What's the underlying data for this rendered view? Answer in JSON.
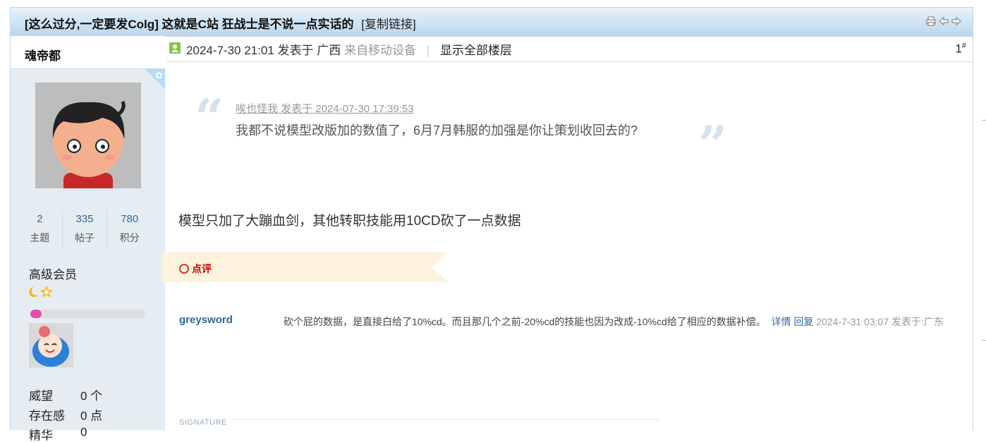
{
  "thread": {
    "title": "[这么过分,一定要发Colg] 这就是C站 狂战士是不说一点实话的",
    "copy_link": "[复制链接]"
  },
  "icons": {
    "print": "printer-icon",
    "prev": "arrow-left-icon",
    "next": "arrow-right-icon"
  },
  "author": {
    "name": "魂帝都",
    "stats": [
      {
        "value": "2",
        "label": "主题"
      },
      {
        "value": "335",
        "label": "帖子"
      },
      {
        "value": "780",
        "label": "积分"
      }
    ],
    "rank": "高级会员",
    "rank_icons": "☾✩",
    "level_progress": 0.1,
    "info": [
      {
        "label": "威望",
        "value": "0 个"
      },
      {
        "label": "存在感",
        "value": "0 点"
      },
      {
        "label": "精华",
        "value": "0"
      }
    ]
  },
  "post": {
    "date": "2024-7-30 21:01",
    "posted_in": "发表于 广西",
    "from_device": "来自移动设备",
    "separator": "|",
    "show_all": "显示全部楼层",
    "floor": "1",
    "floor_mark": "#",
    "quote": {
      "author": "唉也怪我 发表于 2024-07-30 17:39:53",
      "text": "我都不说模型改版加的数值了，6月7月韩服的加强是你让策划收回去的?"
    },
    "body": "模型只加了大蹦血剑，其他转职技能用10CD砍了一点数据"
  },
  "comments": {
    "label": "点评",
    "items": [
      {
        "user": "greysword",
        "text": "砍个屁的数据，是直接白给了10%cd。而且那几个之前-20%cd的技能也因为改成-10%cd给了相应的数据补偿。",
        "detail": "详情",
        "reply": "回复",
        "time": "2024-7-31 03:07 发表于:广东"
      }
    ]
  },
  "signature": "SIGNATURE",
  "colors": {
    "accent": "#336699",
    "progress": "#e34ea6",
    "sidebar_bg": "#e5edf2"
  }
}
